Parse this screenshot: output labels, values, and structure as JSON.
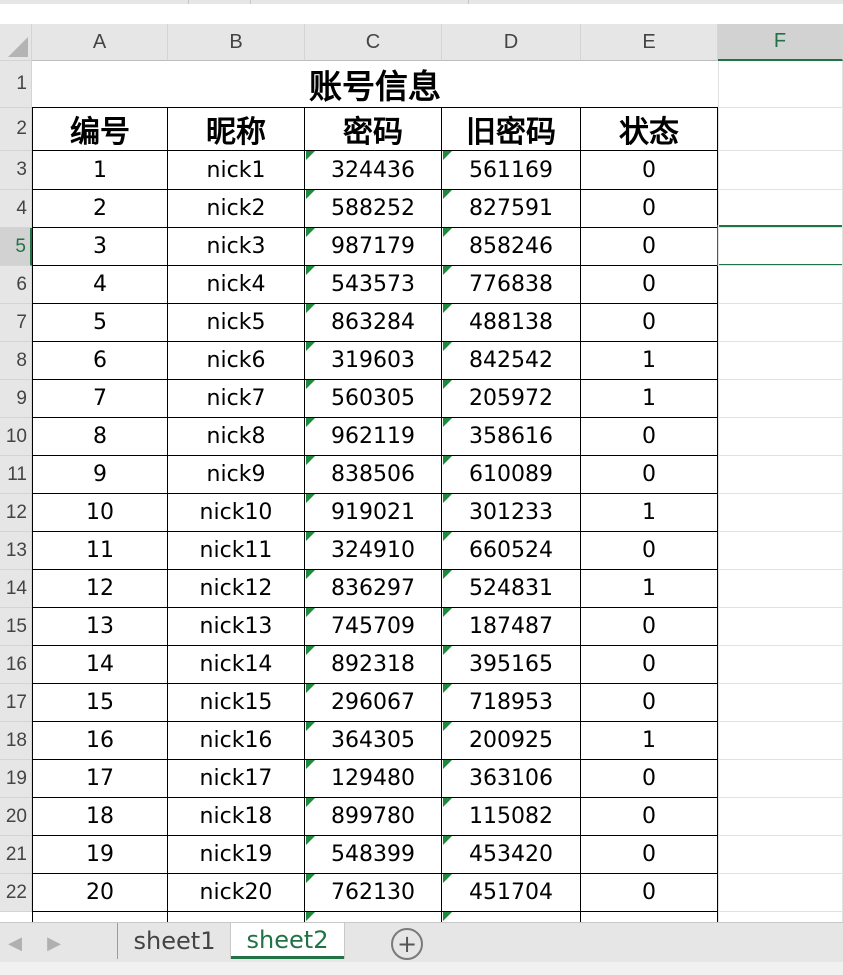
{
  "columns": [
    "A",
    "B",
    "C",
    "D",
    "E",
    "F"
  ],
  "selected_column": "F",
  "rows": [
    "1",
    "2",
    "3",
    "4",
    "5",
    "6",
    "7",
    "8",
    "9",
    "10",
    "11",
    "12",
    "13",
    "14",
    "15",
    "16",
    "17",
    "18",
    "19",
    "20",
    "21",
    "22"
  ],
  "selected_row": "5",
  "sheet": {
    "title": "账号信息",
    "headers": [
      "编号",
      "昵称",
      "密码",
      "旧密码",
      "状态"
    ],
    "data": [
      [
        "1",
        "nick1",
        "324436",
        "561169",
        "0"
      ],
      [
        "2",
        "nick2",
        "588252",
        "827591",
        "0"
      ],
      [
        "3",
        "nick3",
        "987179",
        "858246",
        "0"
      ],
      [
        "4",
        "nick4",
        "543573",
        "776838",
        "0"
      ],
      [
        "5",
        "nick5",
        "863284",
        "488138",
        "0"
      ],
      [
        "6",
        "nick6",
        "319603",
        "842542",
        "1"
      ],
      [
        "7",
        "nick7",
        "560305",
        "205972",
        "1"
      ],
      [
        "8",
        "nick8",
        "962119",
        "358616",
        "0"
      ],
      [
        "9",
        "nick9",
        "838506",
        "610089",
        "0"
      ],
      [
        "10",
        "nick10",
        "919021",
        "301233",
        "1"
      ],
      [
        "11",
        "nick11",
        "324910",
        "660524",
        "0"
      ],
      [
        "12",
        "nick12",
        "836297",
        "524831",
        "1"
      ],
      [
        "13",
        "nick13",
        "745709",
        "187487",
        "0"
      ],
      [
        "14",
        "nick14",
        "892318",
        "395165",
        "0"
      ],
      [
        "15",
        "nick15",
        "296067",
        "718953",
        "0"
      ],
      [
        "16",
        "nick16",
        "364305",
        "200925",
        "1"
      ],
      [
        "17",
        "nick17",
        "129480",
        "363106",
        "0"
      ],
      [
        "18",
        "nick18",
        "899780",
        "115082",
        "0"
      ],
      [
        "19",
        "nick19",
        "548399",
        "453420",
        "0"
      ],
      [
        "20",
        "nick20",
        "762130",
        "451704",
        "0"
      ]
    ]
  },
  "tabs": [
    {
      "label": "sheet1",
      "active": false
    },
    {
      "label": "sheet2",
      "active": true
    }
  ],
  "icons": {
    "prev_sheet": "chevron-left-icon",
    "next_sheet": "chevron-right-icon",
    "add_sheet": "plus-circle-icon"
  },
  "colors": {
    "accent": "#217346",
    "text_flag": "#1f8a3d",
    "header_bg": "#e6e6e6"
  }
}
